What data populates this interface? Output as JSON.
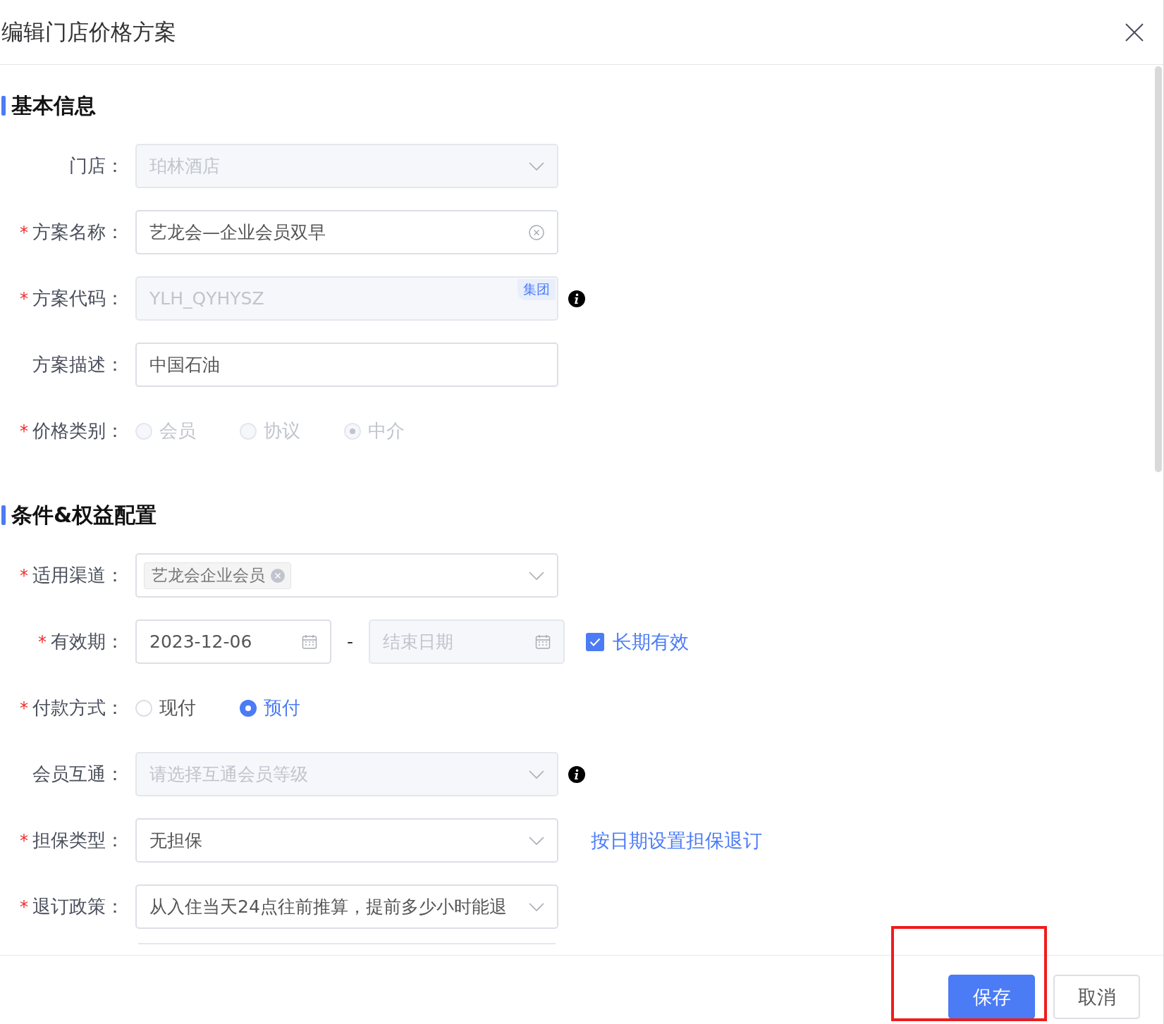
{
  "dialog": {
    "title": "编辑门店价格方案"
  },
  "sections": [
    {
      "title": "基本信息",
      "fields": [
        {
          "kind": "select",
          "label": "门店：",
          "value": "珀林酒店",
          "disabled": true
        },
        {
          "kind": "input",
          "label": "方案名称：",
          "required_mark": "*",
          "value": "艺龙会—企业会员双早",
          "clearable": true,
          "disabled": false
        },
        {
          "kind": "input",
          "label": "方案代码：",
          "required_mark": "*",
          "value": "YLH_QYHYSZ",
          "disabled": true,
          "badge": "集团",
          "info": true
        },
        {
          "kind": "input",
          "label": "方案描述：",
          "value": "中国石油",
          "disabled": false
        },
        {
          "kind": "radio",
          "label": "价格类别：",
          "required_mark": "*",
          "disabled": true,
          "options": [
            {
              "label": "会员",
              "selected": false
            },
            {
              "label": "协议",
              "selected": false
            },
            {
              "label": "中介",
              "selected": true
            }
          ]
        }
      ]
    },
    {
      "title": "条件&权益配置",
      "fields": [
        {
          "kind": "tags",
          "label": "适用渠道：",
          "required_mark": "*",
          "tags": [
            {
              "label": "艺龙会企业会员"
            }
          ]
        },
        {
          "kind": "daterange",
          "label": "有效期：",
          "required_mark": "*",
          "start": "2023-12-06",
          "separator": "-",
          "end_placeholder": "结束日期",
          "end_disabled": true,
          "checkbox": {
            "label": "长期有效",
            "checked": true
          }
        },
        {
          "kind": "radio",
          "label": "付款方式：",
          "required_mark": "*",
          "disabled": false,
          "options": [
            {
              "label": "现付",
              "selected": false
            },
            {
              "label": "预付",
              "selected": true
            }
          ]
        },
        {
          "kind": "select",
          "label": "会员互通：",
          "placeholder": "请选择互通会员等级",
          "disabled": true,
          "info": true
        },
        {
          "kind": "select",
          "label": "担保类型：",
          "required_mark": "*",
          "value": "无担保",
          "disabled": false,
          "link": "按日期设置担保退订"
        },
        {
          "kind": "select",
          "label": "退订政策：",
          "required_mark": "*",
          "value": "从入住当天24点往前推算，提前多少小时能退",
          "disabled": false
        }
      ]
    }
  ],
  "buttons": [
    {
      "label": "保存",
      "kind": "primary"
    },
    {
      "label": "取消",
      "kind": "default"
    }
  ]
}
